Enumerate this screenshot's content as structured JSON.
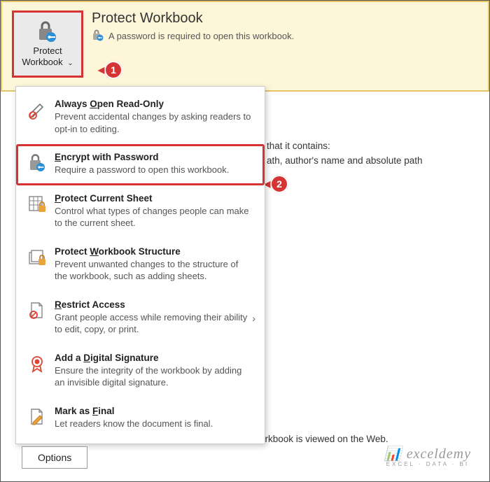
{
  "banner": {
    "title": "Protect Workbook",
    "subtitle": "A password is required to open this workbook.",
    "button_line1": "Protect",
    "button_line2": "Workbook"
  },
  "callouts": {
    "c1": "1",
    "c2": "2"
  },
  "menu": {
    "items": [
      {
        "title_pre": "Always ",
        "title_u": "O",
        "title_post": "pen Read-Only",
        "desc": "Prevent accidental changes by asking readers to opt-in to editing."
      },
      {
        "title_pre": "",
        "title_u": "E",
        "title_post": "ncrypt with Password",
        "desc": "Require a password to open this workbook."
      },
      {
        "title_pre": "",
        "title_u": "P",
        "title_post": "rotect Current Sheet",
        "desc": "Control what types of changes people can make to the current sheet."
      },
      {
        "title_pre": "Protect ",
        "title_u": "W",
        "title_post": "orkbook Structure",
        "desc": "Prevent unwanted changes to the structure of the workbook, such as adding sheets."
      },
      {
        "title_pre": "",
        "title_u": "R",
        "title_post": "estrict Access",
        "desc": "Grant people access while removing their ability to edit, copy, or print."
      },
      {
        "title_pre": "Add a ",
        "title_u": "D",
        "title_post": "igital Signature",
        "desc": "Ensure the integrity of the workbook by adding an invisible digital signature."
      },
      {
        "title_pre": "Mark as ",
        "title_u": "F",
        "title_post": "inal",
        "desc": "Let readers know the document is final."
      }
    ]
  },
  "background": {
    "line1": "that it contains:",
    "line2": "ath, author's name and absolute path",
    "line3": "orkbook is viewed on the Web."
  },
  "options_label": "Options",
  "watermark": {
    "brand": "exceldemy",
    "tag": "EXCEL · DATA · BI"
  }
}
